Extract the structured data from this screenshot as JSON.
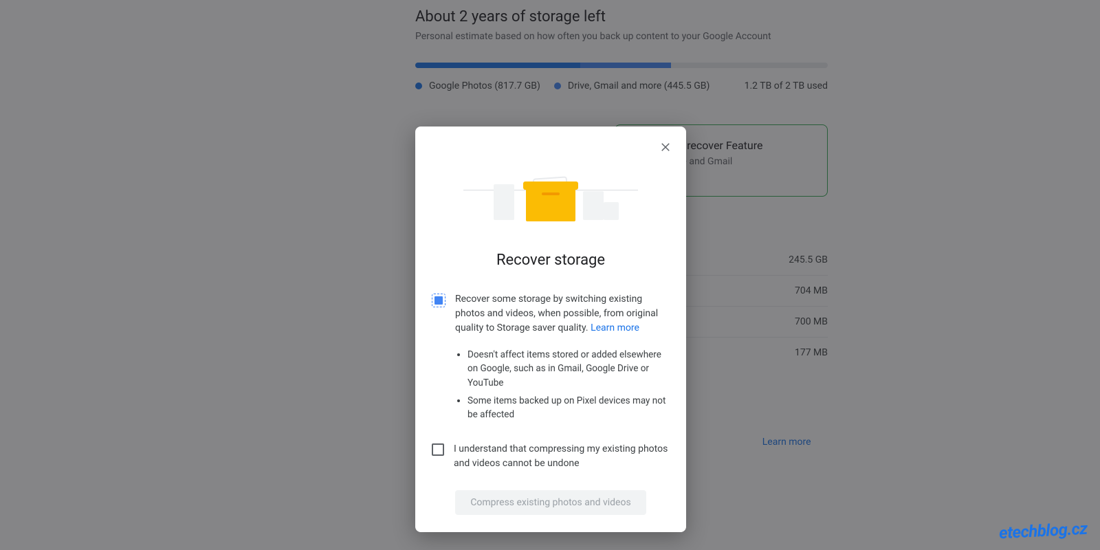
{
  "storage": {
    "title": "About 2 years of storage left",
    "subtitle": "Personal estimate based on how often you back up content to your Google Account",
    "legend_photos": "Google Photos (817.7 GB)",
    "legend_drive": "Drive, Gmail and more (445.5 GB)",
    "used_total": "1.2 TB of 2 TB used"
  },
  "upgrade_card": {
    "title": "Upgrade or recover Feature",
    "subtitle_partial": "Photos, Drive and Gmail"
  },
  "usage_rows": [
    {
      "label": "",
      "value": "245.5 GB"
    },
    {
      "label": "",
      "value": "704 MB"
    },
    {
      "label": "",
      "value": "700 MB"
    },
    {
      "label": "",
      "value": "177 MB"
    }
  ],
  "footer": {
    "link1_partial": "r",
    "learn_more": "Learn more"
  },
  "modal": {
    "title": "Recover storage",
    "description": "Recover some storage by switching existing photos and videos, when possible, from original quality to Storage saver quality. ",
    "learn_more": "Learn more",
    "bullet1": "Doesn't affect items stored or added elsewhere on Google, such as in Gmail, Google Drive or YouTube",
    "bullet2": "Some items backed up on Pixel devices may not be affected",
    "consent": "I understand that compressing my existing photos and videos cannot be undone",
    "action": "Compress existing photos and videos"
  },
  "watermark": "etechblog.cz"
}
